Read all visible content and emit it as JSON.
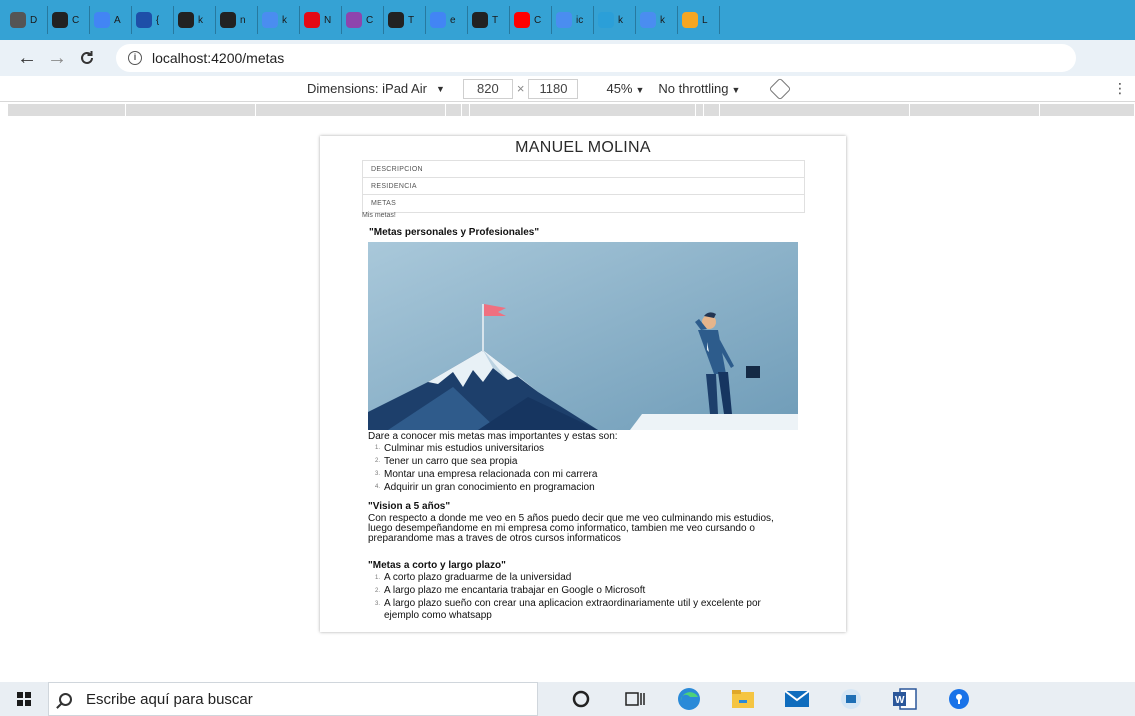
{
  "browser": {
    "tabs": [
      {
        "letter": "D",
        "color": "#555555"
      },
      {
        "letter": "C",
        "color": "#222222"
      },
      {
        "letter": "A",
        "color": "#4285f4"
      },
      {
        "letter": "{",
        "color": "#1e4fa8"
      },
      {
        "letter": "k",
        "color": "#222222"
      },
      {
        "letter": "n",
        "color": "#222222"
      },
      {
        "letter": "k",
        "color": "#4a8df0"
      },
      {
        "letter": "N",
        "color": "#e50914"
      },
      {
        "letter": "C",
        "color": "#8e44ad"
      },
      {
        "letter": "T",
        "color": "#222222"
      },
      {
        "letter": "e",
        "color": "#4285f4"
      },
      {
        "letter": "T",
        "color": "#222222"
      },
      {
        "letter": "C",
        "color": "#ff0000"
      },
      {
        "letter": "ic",
        "color": "#4a8df0"
      },
      {
        "letter": "k",
        "color": "#2b9fd8"
      },
      {
        "letter": "k",
        "color": "#4a8df0"
      },
      {
        "letter": "L",
        "color": "#f5a623"
      }
    ],
    "url": "localhost:4200/metas"
  },
  "devtools": {
    "dimensions_label": "Dimensions: iPad Air",
    "width": "820",
    "height": "1180",
    "times": "×",
    "zoom": "45%",
    "throttling": "No throttling"
  },
  "page": {
    "name": "MANUEL MOLINA",
    "nav": [
      "DESCRIPCION",
      "RESIDENCIA",
      "METAS"
    ],
    "breadcrumb": "Mis metas!",
    "goals_heading": "\"Metas personales y Profesionales\"",
    "intro": "Dare a conocer mis metas mas importantes y estas son:",
    "goals": [
      "Culminar mis estudios universitarios",
      "Tener un carro que sea propia",
      "Montar una empresa relacionada con mi carrera",
      "Adquirir un gran conocimiento en programacion"
    ],
    "vision_heading": "\"Vision a 5 años\"",
    "vision_text": "Con respecto a donde me veo en 5 años puedo decir que me veo culminando mis estudios, luego desempeñandome en mi empresa como informatico, tambien me veo cursando o preparandome mas a traves de otros cursos informaticos",
    "short_long_heading": "\"Metas a corto y largo plazo\"",
    "short_long": [
      "A corto plazo graduarme de la universidad",
      "A largo plazo me encantaria trabajar en Google o Microsoft",
      "A largo plazo sueño con crear una aplicacion extraordinariamente util y excelente por ejemplo como whatsapp"
    ]
  },
  "taskbar": {
    "search_placeholder": "Escribe aquí para buscar"
  },
  "colors": {
    "tabstrip": "#35a2d4",
    "addressbar": "#eaf1f7",
    "taskbar": "#e9eef3",
    "hero_sky": "#8fb4cc"
  }
}
